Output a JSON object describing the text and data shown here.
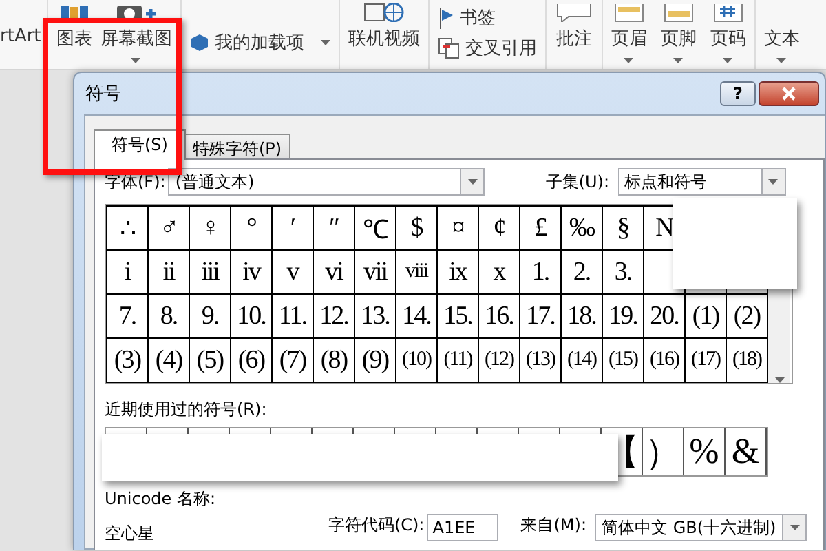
{
  "ribbon": {
    "groups": [
      {
        "kind": "large",
        "items": [
          {
            "label": "rtArt",
            "dropdown": false
          }
        ]
      },
      {
        "kind": "large",
        "items": [
          {
            "label": "图表",
            "dropdown": false
          },
          {
            "label": "屏幕截图",
            "dropdown": true
          }
        ]
      },
      {
        "kind": "small",
        "items": [
          {
            "label": "我的加载项",
            "dropdown": true
          }
        ]
      },
      {
        "kind": "large",
        "items": [
          {
            "label": "联机视频",
            "dropdown": false
          }
        ]
      },
      {
        "kind": "small",
        "items": [
          {
            "label": "书签",
            "dropdown": false
          },
          {
            "label": "交叉引用",
            "dropdown": false
          }
        ]
      },
      {
        "kind": "large",
        "items": [
          {
            "label": "批注",
            "dropdown": false
          }
        ]
      },
      {
        "kind": "large",
        "items": [
          {
            "label": "页眉",
            "dropdown": true
          },
          {
            "label": "页脚",
            "dropdown": true
          },
          {
            "label": "页码",
            "dropdown": true
          }
        ]
      },
      {
        "kind": "large",
        "items": [
          {
            "label": "文本",
            "dropdown": true
          }
        ]
      }
    ]
  },
  "dialog": {
    "title": "符号",
    "help_button": "?",
    "tabs": [
      {
        "label": "符号(S)",
        "selected": true
      },
      {
        "label": "特殊字符(P)",
        "selected": false
      }
    ],
    "font": {
      "label": "字体(F):",
      "value": "(普通文本)"
    },
    "subset": {
      "label": "子集(U):",
      "value": "标点和符号"
    },
    "symbol_grid": [
      [
        "∴",
        "♂",
        "♀",
        "°",
        "′",
        "″",
        "℃",
        "$",
        "¤",
        "¢",
        "£",
        "‰",
        "§",
        "N"
      ],
      [
        "i",
        "ii",
        "iii",
        "iv",
        "v",
        "vi",
        "vii",
        "viii",
        "ix",
        "x",
        "1.",
        "2.",
        "3."
      ],
      [
        "7.",
        "8.",
        "9.",
        "10.",
        "11.",
        "12.",
        "13.",
        "14.",
        "15.",
        "16.",
        "17.",
        "18.",
        "19.",
        "20.",
        "(1)",
        "(2)"
      ],
      [
        "(3)",
        "(4)",
        "(5)",
        "(6)",
        "(7)",
        "(8)",
        "(9)",
        "(10)",
        "(11)",
        "(12)",
        "(13)",
        "(14)",
        "(15)",
        "(16)",
        "(17)",
        "(18)"
      ]
    ],
    "recent": {
      "label": "近期使用过的符号(R):",
      "symbols": [
        "【",
        "）",
        "%",
        "&"
      ]
    },
    "unicode_name": {
      "label": "Unicode 名称:",
      "value": "空心星"
    },
    "char_code": {
      "label": "字符代码(C):",
      "value": "A1EE"
    },
    "from": {
      "label": "来自(M):",
      "value": "简体中文 GB(十六进制)"
    }
  }
}
